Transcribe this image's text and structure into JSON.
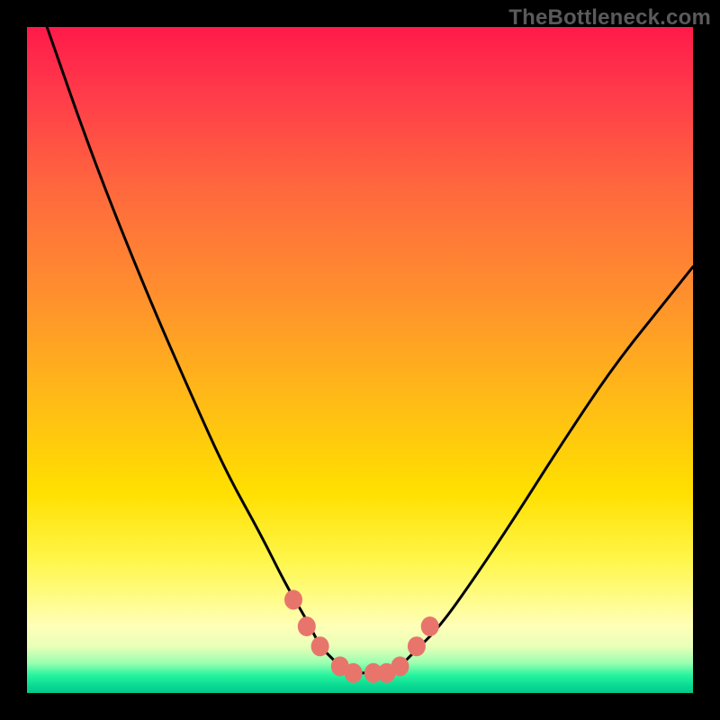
{
  "watermark": "TheBottleneck.com",
  "chart_data": {
    "type": "line",
    "title": "",
    "xlabel": "",
    "ylabel": "",
    "xlim": [
      0,
      100
    ],
    "ylim": [
      0,
      100
    ],
    "grid": false,
    "legend": false,
    "series": [
      {
        "name": "curve",
        "x": [
          3,
          10,
          18,
          25,
          30,
          35,
          39,
          42,
          44,
          46,
          48,
          50,
          52,
          54,
          56,
          58,
          62,
          67,
          73,
          80,
          88,
          96,
          100
        ],
        "values": [
          100,
          80,
          60,
          44,
          33,
          24,
          16,
          11,
          7,
          5,
          3,
          3,
          3,
          3,
          4,
          6,
          10,
          17,
          26,
          37,
          49,
          59,
          64
        ]
      }
    ],
    "markers": {
      "name": "highlight-dots",
      "x": [
        40,
        42,
        44,
        47,
        49,
        52,
        54,
        56,
        58.5,
        60.5
      ],
      "values": [
        14,
        10,
        7,
        4,
        3,
        3,
        3,
        4,
        7,
        10
      ]
    },
    "colors": {
      "curve": "#000000",
      "dots": "#e8756b",
      "gradient_top": "#ff1a4a",
      "gradient_mid": "#ffe000",
      "gradient_bottom": "#06c88a"
    }
  }
}
